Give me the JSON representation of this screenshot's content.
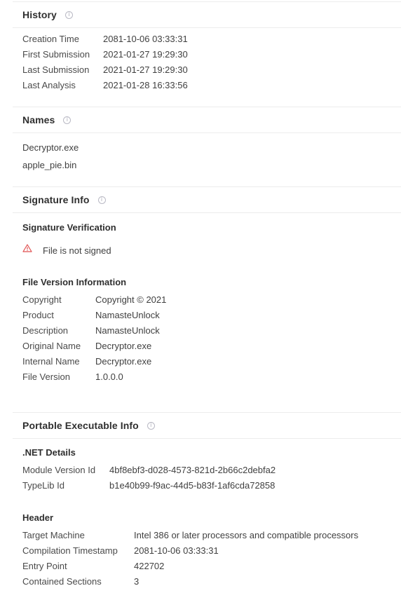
{
  "history": {
    "title": "History",
    "rows": [
      {
        "label": "Creation Time",
        "value": "2081-10-06 03:33:31"
      },
      {
        "label": "First Submission",
        "value": "2021-01-27 19:29:30"
      },
      {
        "label": "Last Submission",
        "value": "2021-01-27 19:29:30"
      },
      {
        "label": "Last Analysis",
        "value": "2021-01-28 16:33:56"
      }
    ]
  },
  "names": {
    "title": "Names",
    "items": [
      "Decryptor.exe",
      "apple_pie.bin"
    ]
  },
  "signature": {
    "title": "Signature Info",
    "verification_title": "Signature Verification",
    "verification_status": "File is not signed",
    "version_title": "File Version Information",
    "rows": [
      {
        "label": "Copyright",
        "value": "Copyright © 2021"
      },
      {
        "label": "Product",
        "value": "NamasteUnlock"
      },
      {
        "label": "Description",
        "value": "NamasteUnlock"
      },
      {
        "label": "Original Name",
        "value": "Decryptor.exe"
      },
      {
        "label": "Internal Name",
        "value": "Decryptor.exe"
      },
      {
        "label": "File Version",
        "value": "1.0.0.0"
      }
    ]
  },
  "pe": {
    "title": "Portable Executable Info",
    "net_title": ".NET Details",
    "net_rows": [
      {
        "label": "Module Version Id",
        "value": "4bf8ebf3-d028-4573-821d-2b66c2debfa2"
      },
      {
        "label": "TypeLib Id",
        "value": "b1e40b99-f9ac-44d5-b83f-1af6cda72858"
      }
    ],
    "header_title": "Header",
    "header_rows": [
      {
        "label": "Target Machine",
        "value": "Intel 386 or later processors and compatible processors"
      },
      {
        "label": "Compilation Timestamp",
        "value": "2081-10-06 03:33:31"
      },
      {
        "label": "Entry Point",
        "value": "422702"
      },
      {
        "label": "Contained Sections",
        "value": "3"
      }
    ]
  },
  "colors": {
    "warning": "#e05252",
    "info_icon": "#a9a9b6",
    "divider": "#ececec"
  },
  "icons": {
    "info": "info-icon",
    "warning": "warning-icon"
  }
}
